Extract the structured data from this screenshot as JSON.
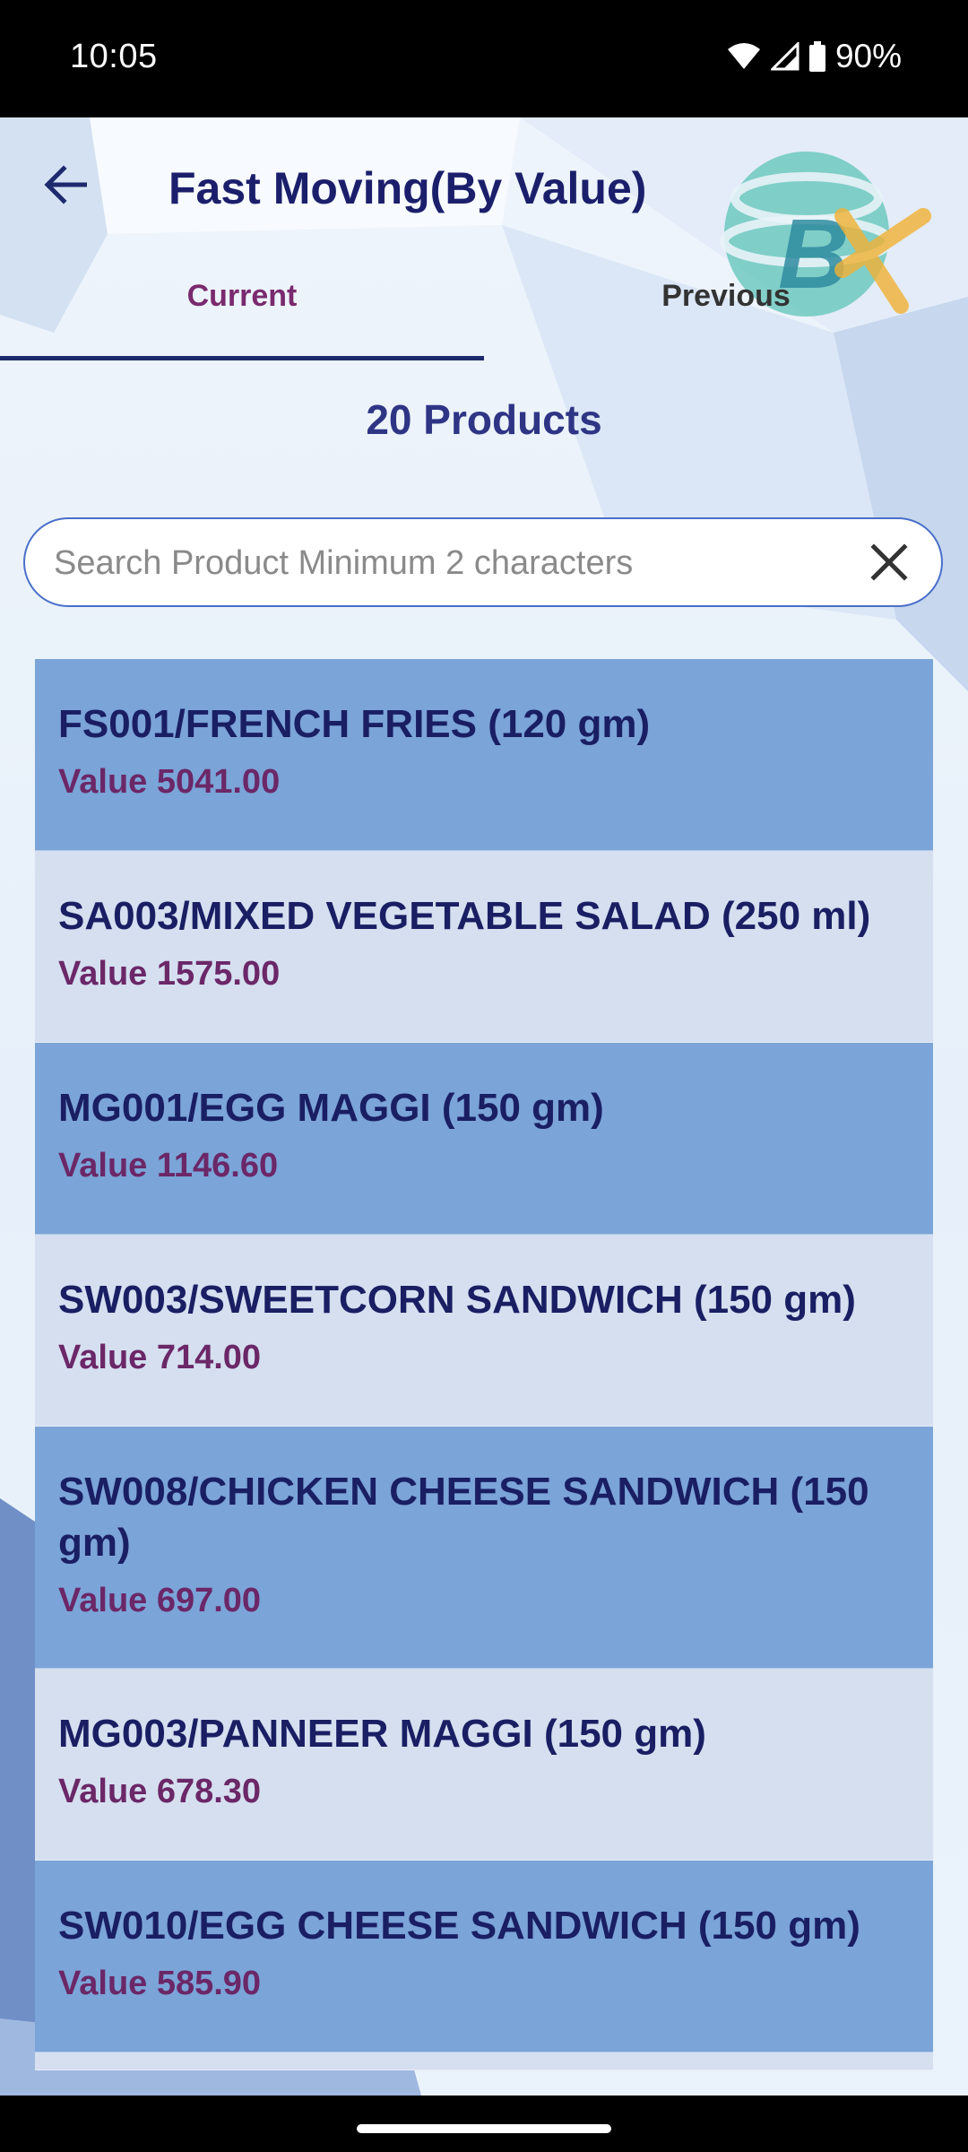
{
  "status_bar": {
    "time": "10:05",
    "battery": "90%",
    "icons": [
      "wifi-icon",
      "signal-icon",
      "battery-icon"
    ]
  },
  "header": {
    "title": "Fast Moving(By Value)",
    "back_icon": "arrow-left-icon",
    "logo": "bx-logo"
  },
  "tabs": [
    {
      "label": "Current",
      "selected": true
    },
    {
      "label": "Previous",
      "selected": false
    }
  ],
  "product_count": "20 Products",
  "search": {
    "placeholder": "Search Product Minimum 2 characters",
    "value": "",
    "clear_icon": "close-icon"
  },
  "products": [
    {
      "name": "FS001/FRENCH FRIES (120 gm)",
      "value": "Value 5041.00"
    },
    {
      "name": "SA003/MIXED VEGETABLE SALAD (250 ml)",
      "value": "Value 1575.00"
    },
    {
      "name": "MG001/EGG MAGGI (150 gm)",
      "value": "Value 1146.60"
    },
    {
      "name": "SW003/SWEETCORN SANDWICH (150 gm)",
      "value": "Value 714.00"
    },
    {
      "name": "SW008/CHICKEN CHEESE SANDWICH (150 gm)",
      "value": "Value 697.00"
    },
    {
      "name": "MG003/PANNEER MAGGI (150 gm)",
      "value": "Value 678.30"
    },
    {
      "name": "SW010/EGG CHEESE SANDWICH (150 gm)",
      "value": "Value 585.90"
    }
  ],
  "colors": {
    "title": "#1b1f6b",
    "tab_selected": "#7a2a6e",
    "row_dark": "#7ba4d8",
    "row_light": "#d5dff0",
    "value_text": "#6b2767"
  }
}
